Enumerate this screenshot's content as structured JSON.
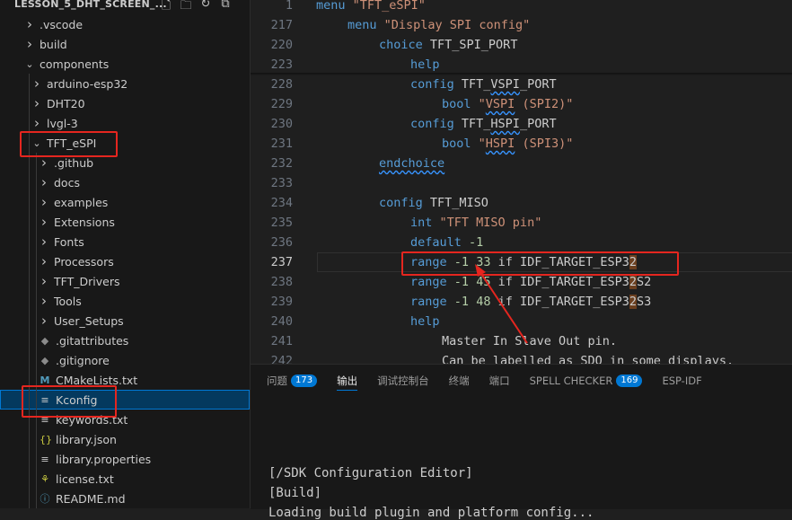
{
  "explorer": {
    "title": "LESSON_5_DHT_SCREEN_...",
    "actions": [
      "new-file-icon",
      "new-folder-icon",
      "refresh-icon",
      "collapse-icon"
    ],
    "items": [
      {
        "label": ".vscode",
        "type": "folder",
        "depth": 0,
        "expanded": false
      },
      {
        "label": "build",
        "type": "folder",
        "depth": 0,
        "expanded": false
      },
      {
        "label": "components",
        "type": "folder",
        "depth": 0,
        "expanded": true
      },
      {
        "label": "arduino-esp32",
        "type": "folder",
        "depth": 1,
        "expanded": false
      },
      {
        "label": "DHT20",
        "type": "folder",
        "depth": 1,
        "expanded": false
      },
      {
        "label": "lvgl-3",
        "type": "folder",
        "depth": 1,
        "expanded": false
      },
      {
        "label": "TFT_eSPI",
        "type": "folder",
        "depth": 1,
        "expanded": true
      },
      {
        "label": ".github",
        "type": "folder",
        "depth": 2,
        "expanded": false
      },
      {
        "label": "docs",
        "type": "folder",
        "depth": 2,
        "expanded": false
      },
      {
        "label": "examples",
        "type": "folder",
        "depth": 2,
        "expanded": false
      },
      {
        "label": "Extensions",
        "type": "folder",
        "depth": 2,
        "expanded": false
      },
      {
        "label": "Fonts",
        "type": "folder",
        "depth": 2,
        "expanded": false
      },
      {
        "label": "Processors",
        "type": "folder",
        "depth": 2,
        "expanded": false
      },
      {
        "label": "TFT_Drivers",
        "type": "folder",
        "depth": 2,
        "expanded": false
      },
      {
        "label": "Tools",
        "type": "folder",
        "depth": 2,
        "expanded": false
      },
      {
        "label": "User_Setups",
        "type": "folder",
        "depth": 2,
        "expanded": false
      },
      {
        "label": ".gitattributes",
        "type": "file",
        "depth": 2,
        "icon": "git-icon",
        "iconColor": "#8b8b8b"
      },
      {
        "label": ".gitignore",
        "type": "file",
        "depth": 2,
        "icon": "git-icon",
        "iconColor": "#8b8b8b"
      },
      {
        "label": "CMakeLists.txt",
        "type": "file",
        "depth": 2,
        "icon": "cmake-icon",
        "iconColor": "#519aba"
      },
      {
        "label": "Kconfig",
        "type": "file",
        "depth": 2,
        "icon": "lines-icon",
        "iconColor": "#cccccc",
        "selected": true
      },
      {
        "label": "keywords.txt",
        "type": "file",
        "depth": 2,
        "icon": "lines-icon",
        "iconColor": "#cccccc"
      },
      {
        "label": "library.json",
        "type": "file",
        "depth": 2,
        "icon": "json-braces-icon",
        "iconColor": "#cbcb41"
      },
      {
        "label": "library.properties",
        "type": "file",
        "depth": 2,
        "icon": "lines-icon",
        "iconColor": "#cccccc"
      },
      {
        "label": "license.txt",
        "type": "file",
        "depth": 2,
        "icon": "license-icon",
        "iconColor": "#cbcb41"
      },
      {
        "label": "README.md",
        "type": "file",
        "depth": 2,
        "icon": "info-icon",
        "iconColor": "#519aba"
      }
    ]
  },
  "editor": {
    "lines": [
      {
        "n": "1",
        "indent": 0,
        "tokens": [
          [
            "kw",
            "menu"
          ],
          [
            "plain",
            " "
          ],
          [
            "str",
            "\"TFT_eSPI\""
          ]
        ]
      },
      {
        "n": "217",
        "indent": 1,
        "tokens": [
          [
            "kw",
            "menu"
          ],
          [
            "plain",
            " "
          ],
          [
            "str",
            "\"Display SPI config\""
          ]
        ]
      },
      {
        "n": "220",
        "indent": 2,
        "tokens": [
          [
            "kw",
            "choice"
          ],
          [
            "plain",
            " TFT_SPI_PORT"
          ]
        ]
      },
      {
        "n": "223",
        "indent": 3,
        "tokens": [
          [
            "kw",
            "help"
          ]
        ]
      },
      {
        "n": "228",
        "indent": 3,
        "tokens": [
          [
            "kw",
            "config"
          ],
          [
            "plain",
            " TFT_"
          ],
          [
            "sq",
            "VSPI"
          ],
          [
            "plain",
            "_PORT"
          ]
        ]
      },
      {
        "n": "229",
        "indent": 4,
        "tokens": [
          [
            "kw",
            "bool"
          ],
          [
            "plain",
            " "
          ],
          [
            "str",
            "\""
          ],
          [
            "strsq",
            "VSPI"
          ],
          [
            "str",
            " (SPI2)\""
          ]
        ]
      },
      {
        "n": "230",
        "indent": 3,
        "tokens": [
          [
            "kw",
            "config"
          ],
          [
            "plain",
            " TFT_"
          ],
          [
            "sq",
            "HSPI"
          ],
          [
            "plain",
            "_PORT"
          ]
        ]
      },
      {
        "n": "231",
        "indent": 4,
        "tokens": [
          [
            "kw",
            "bool"
          ],
          [
            "plain",
            " "
          ],
          [
            "str",
            "\""
          ],
          [
            "strsq",
            "HSPI"
          ],
          [
            "str",
            " (SPI3)\""
          ]
        ]
      },
      {
        "n": "232",
        "indent": 2,
        "tokens": [
          [
            "kwsq",
            "endchoice"
          ]
        ]
      },
      {
        "n": "233",
        "indent": 0,
        "tokens": []
      },
      {
        "n": "234",
        "indent": 2,
        "tokens": [
          [
            "kw",
            "config"
          ],
          [
            "plain",
            " TFT_MISO"
          ]
        ]
      },
      {
        "n": "235",
        "indent": 3,
        "tokens": [
          [
            "kw",
            "int"
          ],
          [
            "plain",
            " "
          ],
          [
            "str",
            "\"TFT MISO pin\""
          ]
        ]
      },
      {
        "n": "236",
        "indent": 3,
        "tokens": [
          [
            "kw",
            "default"
          ],
          [
            "plain",
            " "
          ],
          [
            "num",
            "-1"
          ]
        ]
      },
      {
        "n": "237",
        "indent": 3,
        "active": true,
        "tokens": [
          [
            "kw",
            "range"
          ],
          [
            "plain",
            " "
          ],
          [
            "num",
            "-1"
          ],
          [
            "plain",
            " "
          ],
          [
            "num",
            "33"
          ],
          [
            "plain",
            " if IDF_TARGET_ESP3"
          ],
          [
            "hl",
            "2"
          ]
        ]
      },
      {
        "n": "238",
        "indent": 3,
        "tokens": [
          [
            "kw",
            "range"
          ],
          [
            "plain",
            " "
          ],
          [
            "num",
            "-1"
          ],
          [
            "plain",
            " "
          ],
          [
            "num",
            "45"
          ],
          [
            "plain",
            " if IDF_TARGET_ESP3"
          ],
          [
            "hl",
            "2"
          ],
          [
            "plain",
            "S2"
          ]
        ]
      },
      {
        "n": "239",
        "indent": 3,
        "tokens": [
          [
            "kw",
            "range"
          ],
          [
            "plain",
            " "
          ],
          [
            "num",
            "-1"
          ],
          [
            "plain",
            " "
          ],
          [
            "num",
            "48"
          ],
          [
            "plain",
            " if IDF_TARGET_ESP3"
          ],
          [
            "hl",
            "2"
          ],
          [
            "plain",
            "S3"
          ]
        ]
      },
      {
        "n": "240",
        "indent": 3,
        "tokens": [
          [
            "kw",
            "help"
          ]
        ]
      },
      {
        "n": "241",
        "indent": 4,
        "tokens": [
          [
            "plain",
            "Master In Slave Out pin."
          ]
        ]
      },
      {
        "n": "242",
        "indent": 4,
        "tokens": [
          [
            "plain",
            "Can be labelled as SDO in some displays."
          ]
        ]
      }
    ]
  },
  "panel": {
    "tabs": [
      {
        "label": "问题",
        "badge": "173"
      },
      {
        "label": "输出",
        "active": true
      },
      {
        "label": "调试控制台"
      },
      {
        "label": "终端"
      },
      {
        "label": "端口"
      },
      {
        "label": "SPELL CHECKER",
        "badge": "169"
      },
      {
        "label": "ESP-IDF"
      }
    ],
    "output": [
      "[/SDK Configuration Editor]",
      "[Build]",
      "Loading build plugin and platform config..."
    ]
  },
  "colors": {
    "highlight_box": "#e5261f",
    "accent": "#0078d4",
    "keyword": "#569cd6",
    "string": "#ce9178"
  }
}
